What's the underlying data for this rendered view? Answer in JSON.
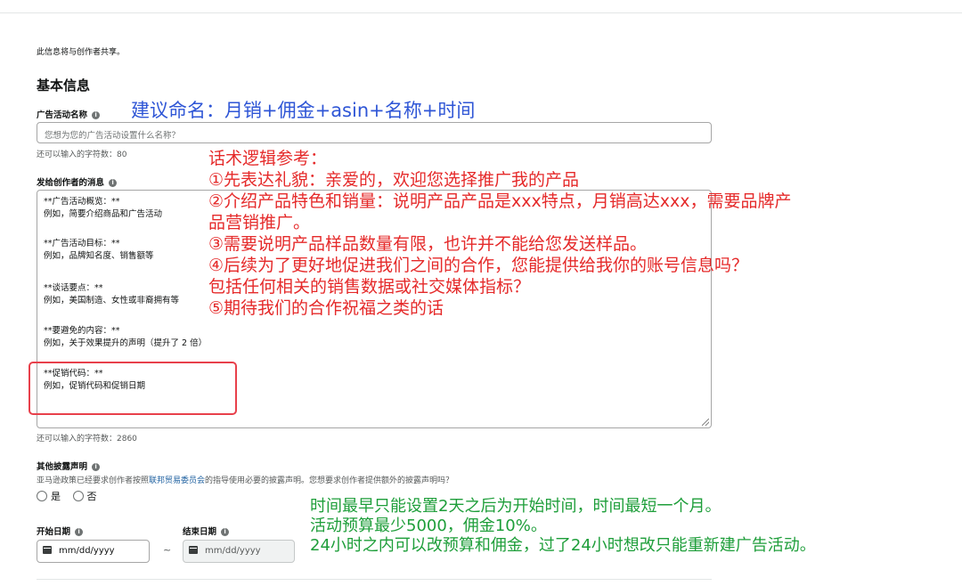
{
  "notice": "此信息将与创作者共享。",
  "basic_info": {
    "heading": "基本信息",
    "campaign_name_label": "广告活动名称",
    "campaign_name_placeholder": "您想为您的广告活动设置什么名称？",
    "campaign_name_remaining": "还可以输入的字符数：80",
    "message_label": "发给创作者的消息",
    "message_remaining": "还可以输入的字符数：2860",
    "message_blocks": [
      {
        "title": "**广告活动概览：**",
        "text": "例如，简要介绍商品和广告活动"
      },
      {
        "title": "**广告活动目标：**",
        "text": "例如，品牌知名度、销售额等"
      },
      {
        "title": "**谈话要点：**",
        "text": "例如，美国制造、女性或非裔拥有等"
      },
      {
        "title": "**要避免的内容：**",
        "text": "例如，关于效果提升的声明（提升了 2 倍）"
      },
      {
        "title": "**促销代码：**",
        "text": "例如，促销代码和促销日期"
      }
    ]
  },
  "disclosure": {
    "label": "其他披露声明",
    "desc_before": "亚马逊政策已经要求创作者按照",
    "desc_link": "联邦贸易委员会",
    "desc_after": "的指导使用必要的披露声明。您想要求创作者提供额外的披露声明吗？",
    "option_yes": "是",
    "option_no": "否"
  },
  "dates": {
    "start_label": "开始日期",
    "end_label": "结束日期",
    "start_placeholder": "mm/dd/yyyy",
    "end_placeholder": "mm/dd/yyyy",
    "separator": "~"
  },
  "annotations": {
    "naming": "建议命名：月销+佣金+asin+名称+时间",
    "script_lines": [
      "话术逻辑参考：",
      "①先表达礼貌：亲爱的，欢迎您选择推广我的产品",
      "②介绍产品特色和销量：说明产品产品是xxx特点，月销高达xxx，需要品牌产",
      "品营销推广。",
      "③需要说明产品样品数量有限，也许并不能给您发送样品。",
      "④后续为了更好地促进我们之间的合作，您能提供给我你的账号信息吗？",
      "包括任何相关的销售数据或社交媒体指标？",
      "⑤期待我们的合作祝福之类的话"
    ],
    "time_lines": [
      "时间最早只能设置2天之后为开始时间，时间最短一个月。",
      "活动预算最少5000，佣金10%。",
      "24小时之内可以改预算和佣金，过了24小时想改只能重新建广告活动。"
    ]
  },
  "colors": {
    "annotation_blue": "#2f56d6",
    "annotation_red": "#e52a2a",
    "annotation_green": "#1e9e3a",
    "highlight_box": "#e8404b"
  }
}
